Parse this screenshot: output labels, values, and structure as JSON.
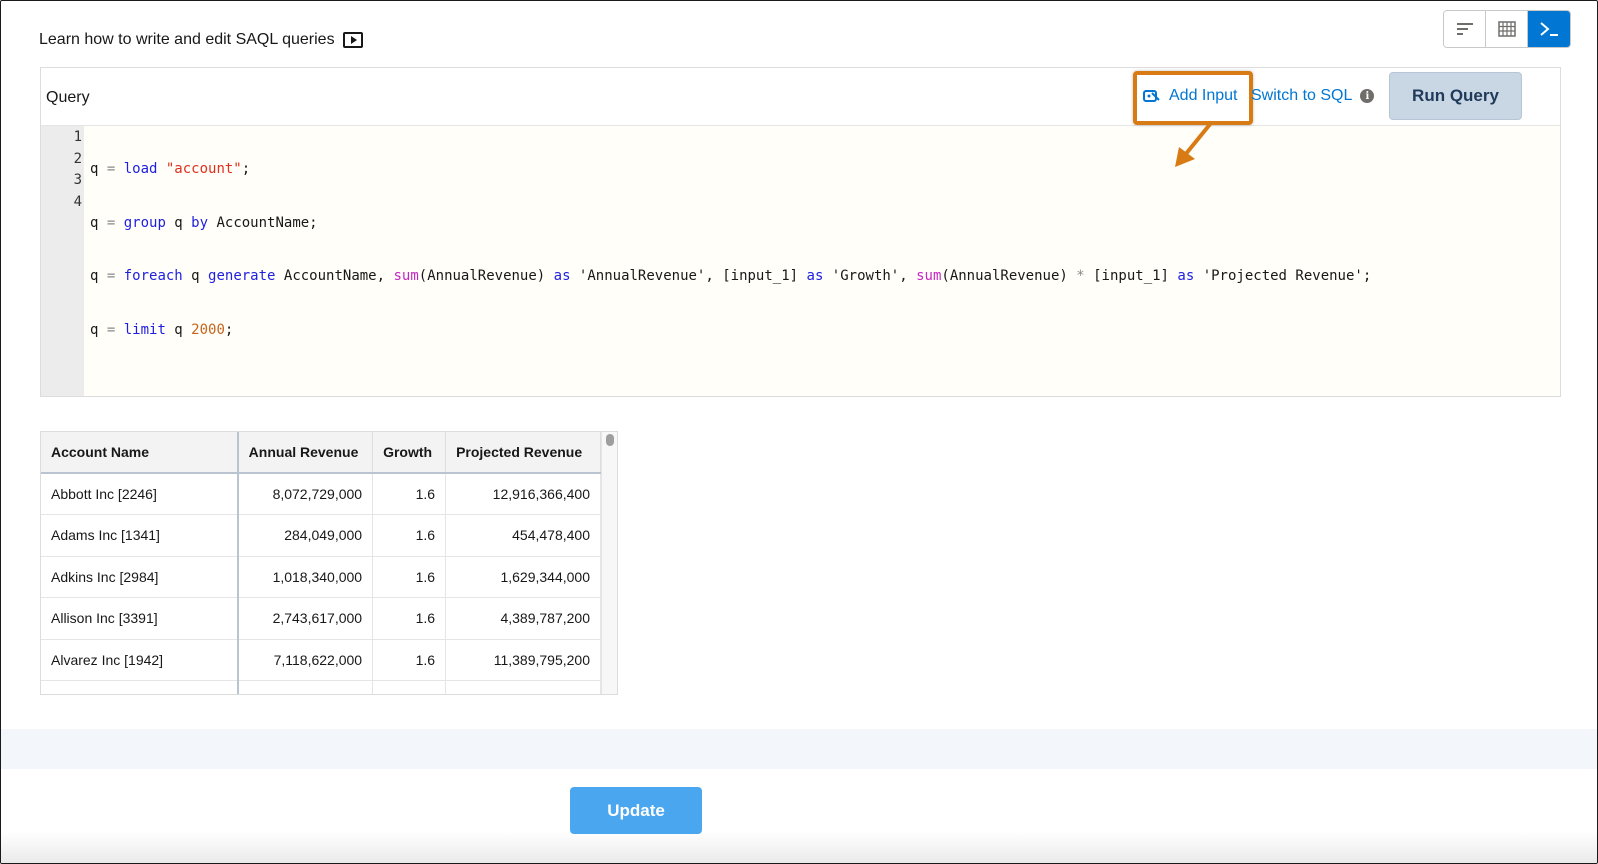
{
  "header": {
    "learn_text": "Learn how to write and edit SAQL queries"
  },
  "view_toggle": {
    "items": [
      "chart-view",
      "table-view",
      "query-view"
    ],
    "active": "query-view"
  },
  "editor": {
    "label": "Query",
    "add_input_label": "Add Input",
    "switch_sql_label": "Switch to SQL",
    "run_query_label": "Run Query",
    "line_numbers": [
      "1",
      "2",
      "3",
      "4"
    ],
    "code": {
      "l1": {
        "a": "q ",
        "eq": "=",
        "kw": " load ",
        "str": "\"account\"",
        "end": ";"
      },
      "l2": {
        "a": "q ",
        "eq": "=",
        "kw1": " group",
        "mid": " q ",
        "kw2": "by",
        "end": " AccountName;"
      },
      "l3": {
        "a": "q ",
        "eq": "=",
        "kw1": " foreach",
        "mid1": " q ",
        "kw2": "generate",
        "p1": " AccountName, ",
        "fn1": "sum",
        "p2": "(AnnualRevenue) ",
        "as1": "as",
        "p3": " 'AnnualRevenue', [input_1] ",
        "as2": "as",
        "p4": " 'Growth', ",
        "fn2": "sum",
        "p5": "(AnnualRevenue) ",
        "mul": "*",
        "p6": " [input_1] ",
        "as3": "as",
        "p7": " 'Projected Revenue';"
      },
      "l4": {
        "a": "q ",
        "eq": "=",
        "kw": " limit",
        "mid": " q ",
        "num": "2000",
        "end": ";"
      }
    }
  },
  "colors": {
    "accent": "#0176d3",
    "highlight": "#d97b14",
    "run_button": "#c9d6e3",
    "update_button": "#4aa6ee"
  },
  "table": {
    "headers": [
      "Account Name",
      "Annual Revenue",
      "Growth",
      "Projected Revenue"
    ],
    "rows": [
      [
        "Abbott Inc [2246]",
        "8,072,729,000",
        "1.6",
        "12,916,366,400"
      ],
      [
        "Adams Inc [1341]",
        "284,049,000",
        "1.6",
        "454,478,400"
      ],
      [
        "Adkins Inc [2984]",
        "1,018,340,000",
        "1.6",
        "1,629,344,000"
      ],
      [
        "Allison Inc [3391]",
        "2,743,617,000",
        "1.6",
        "4,389,787,200"
      ],
      [
        "Alvarez Inc [1942]",
        "7,118,622,000",
        "1.6",
        "11,389,795,200"
      ]
    ]
  },
  "footer": {
    "update_label": "Update"
  }
}
